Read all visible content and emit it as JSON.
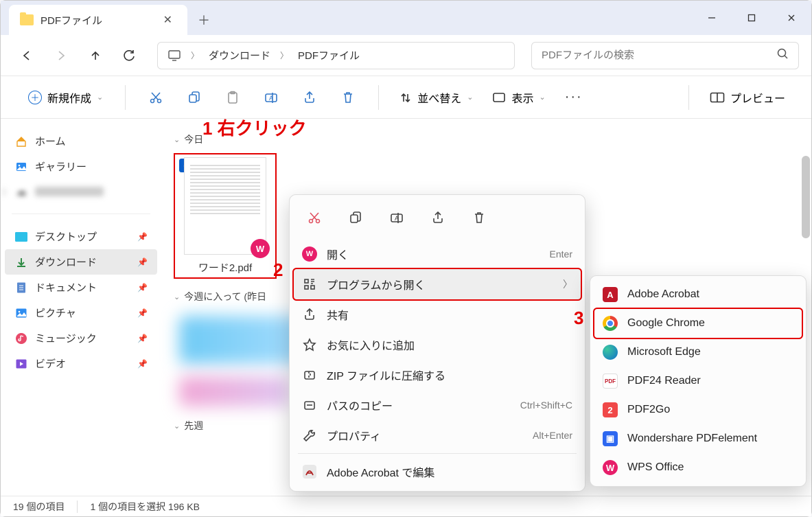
{
  "window": {
    "tab_title": "PDFファイル",
    "min": "—",
    "max": "□",
    "close": "✕"
  },
  "nav": {
    "breadcrumb": {
      "seg1": "ダウンロード",
      "seg2": "PDFファイル"
    },
    "search_placeholder": "PDFファイルの検索"
  },
  "toolbar": {
    "new_label": "新規作成",
    "sort_label": "並べ替え",
    "view_label": "表示",
    "preview_label": "プレビュー"
  },
  "sidebar": {
    "home": "ホーム",
    "gallery": "ギャラリー",
    "desktop": "デスクトップ",
    "downloads": "ダウンロード",
    "documents": "ドキュメント",
    "pictures": "ピクチャ",
    "music": "ミュージック",
    "videos": "ビデオ"
  },
  "content": {
    "group_today": "今日",
    "group_thisweek": "今週に入って (昨日",
    "group_lastweek": "先週",
    "file1_name": "ワード2.pdf"
  },
  "annotations": {
    "a1": "1 右クリック",
    "a2": "2",
    "a3": "3"
  },
  "ctx": {
    "open": "開く",
    "open_sc": "Enter",
    "openwith": "プログラムから開く",
    "share": "共有",
    "favorite": "お気に入りに追加",
    "zip": "ZIP ファイルに圧縮する",
    "copypath": "パスのコピー",
    "copypath_sc": "Ctrl+Shift+C",
    "properties": "プロパティ",
    "properties_sc": "Alt+Enter",
    "acrobat_edit": "Adobe Acrobat で編集"
  },
  "submenu": {
    "acrobat": "Adobe Acrobat",
    "chrome": "Google Chrome",
    "edge": "Microsoft Edge",
    "pdf24": "PDF24 Reader",
    "pdf2go": "PDF2Go",
    "wondershare": "Wondershare PDFelement",
    "wps": "WPS Office"
  },
  "status": {
    "count": "19 個の項目",
    "selected": "1 個の項目を選択 196 KB"
  }
}
